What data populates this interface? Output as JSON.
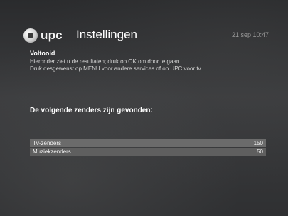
{
  "brand": {
    "name": "upc"
  },
  "header": {
    "title": "Instellingen",
    "datetime": "21 sep 10:47"
  },
  "status": {
    "title": "Voltooid",
    "lines": [
      "Hieronder ziet u de resultaten; druk op OK om door te gaan.",
      "Druk desgewenst op MENU voor andere services of op UPC voor tv."
    ]
  },
  "found": {
    "heading": "De volgende zenders zijn gevonden:"
  },
  "results": [
    {
      "label": "Tv-zenders",
      "count": "150"
    },
    {
      "label": "Muziekzenders",
      "count": "50"
    }
  ]
}
